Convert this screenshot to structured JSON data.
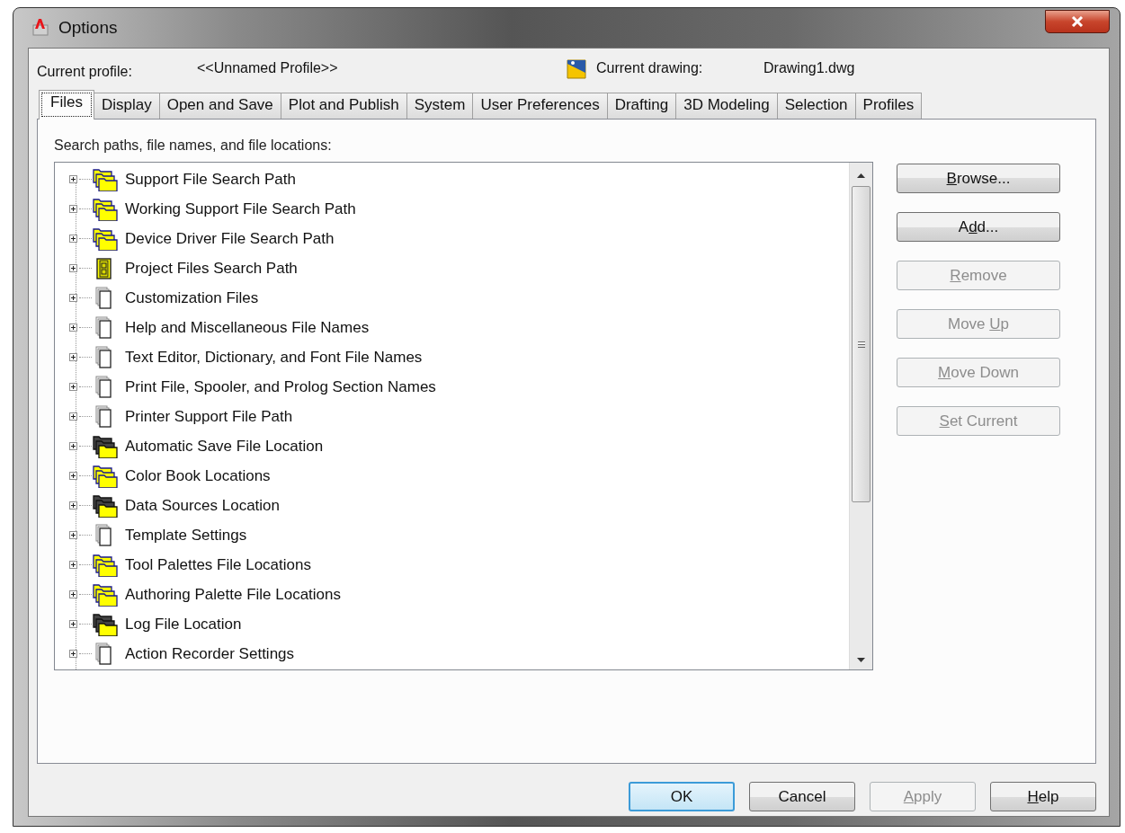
{
  "window": {
    "title": "Options"
  },
  "profile": {
    "label": "Current profile:",
    "value": "<<Unnamed Profile>>",
    "drawing_label": "Current drawing:",
    "drawing_value": "Drawing1.dwg"
  },
  "tabs": [
    {
      "label": "Files",
      "selected": true
    },
    {
      "label": "Display",
      "selected": false
    },
    {
      "label": "Open and Save",
      "selected": false
    },
    {
      "label": "Plot and Publish",
      "selected": false
    },
    {
      "label": "System",
      "selected": false
    },
    {
      "label": "User Preferences",
      "selected": false
    },
    {
      "label": "Drafting",
      "selected": false
    },
    {
      "label": "3D Modeling",
      "selected": false
    },
    {
      "label": "Selection",
      "selected": false
    },
    {
      "label": "Profiles",
      "selected": false
    }
  ],
  "tree": {
    "caption": "Search paths, file names, and file locations:",
    "items": [
      {
        "label": "Support File Search Path",
        "kind": "folders",
        "expanded": false
      },
      {
        "label": "Working Support File Search Path",
        "kind": "folders",
        "expanded": false
      },
      {
        "label": "Device Driver File Search Path",
        "kind": "folders",
        "expanded": false
      },
      {
        "label": "Project Files Search Path",
        "kind": "cabinet",
        "expanded": false
      },
      {
        "label": "Customization Files",
        "kind": "document",
        "expanded": false
      },
      {
        "label": "Help and Miscellaneous File Names",
        "kind": "document",
        "expanded": false
      },
      {
        "label": "Text Editor, Dictionary, and Font File Names",
        "kind": "document",
        "expanded": false
      },
      {
        "label": "Print File, Spooler, and Prolog Section Names",
        "kind": "document",
        "expanded": false
      },
      {
        "label": "Printer Support File Path",
        "kind": "document",
        "expanded": false
      },
      {
        "label": "Automatic Save File Location",
        "kind": "dark-folders",
        "expanded": false
      },
      {
        "label": "Color Book Locations",
        "kind": "folders",
        "expanded": false
      },
      {
        "label": "Data Sources Location",
        "kind": "dark-folders",
        "expanded": false
      },
      {
        "label": "Template Settings",
        "kind": "document",
        "expanded": false
      },
      {
        "label": "Tool Palettes File Locations",
        "kind": "folders",
        "expanded": false
      },
      {
        "label": "Authoring Palette File Locations",
        "kind": "folders",
        "expanded": false
      },
      {
        "label": "Log File Location",
        "kind": "dark-folders",
        "expanded": false
      },
      {
        "label": "Action Recorder Settings",
        "kind": "document",
        "expanded": false
      }
    ]
  },
  "side_buttons": [
    {
      "key": "B",
      "after": "rowse...",
      "disabled": false
    },
    {
      "before": "A",
      "key": "d",
      "after": "d...",
      "disabled": false
    },
    {
      "key": "R",
      "after": "emove",
      "disabled": true
    },
    {
      "before": "Move ",
      "key": "U",
      "after": "p",
      "disabled": true
    },
    {
      "key": "M",
      "after": "ove Down",
      "disabled": true
    },
    {
      "key": "S",
      "after": "et Current",
      "disabled": true
    }
  ],
  "footer_buttons": [
    {
      "before": "OK",
      "disabled": false,
      "default": true
    },
    {
      "before": "Cancel",
      "disabled": false,
      "default": false
    },
    {
      "key": "A",
      "after": "pply",
      "disabled": true,
      "default": false
    },
    {
      "key": "H",
      "after": "elp",
      "disabled": false,
      "default": false
    }
  ]
}
